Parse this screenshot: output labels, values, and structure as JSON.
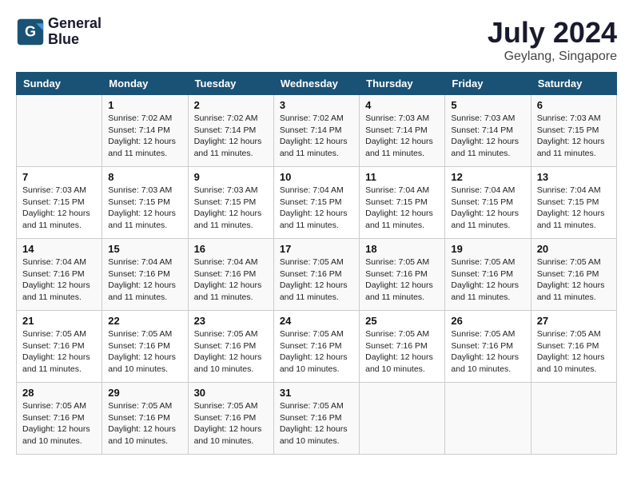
{
  "logo": {
    "line1": "General",
    "line2": "Blue"
  },
  "title": "July 2024",
  "location": "Geylang, Singapore",
  "days_header": [
    "Sunday",
    "Monday",
    "Tuesday",
    "Wednesday",
    "Thursday",
    "Friday",
    "Saturday"
  ],
  "weeks": [
    [
      {
        "day": "",
        "sunrise": "",
        "sunset": "",
        "daylight": ""
      },
      {
        "day": "1",
        "sunrise": "Sunrise: 7:02 AM",
        "sunset": "Sunset: 7:14 PM",
        "daylight": "Daylight: 12 hours and 11 minutes."
      },
      {
        "day": "2",
        "sunrise": "Sunrise: 7:02 AM",
        "sunset": "Sunset: 7:14 PM",
        "daylight": "Daylight: 12 hours and 11 minutes."
      },
      {
        "day": "3",
        "sunrise": "Sunrise: 7:02 AM",
        "sunset": "Sunset: 7:14 PM",
        "daylight": "Daylight: 12 hours and 11 minutes."
      },
      {
        "day": "4",
        "sunrise": "Sunrise: 7:03 AM",
        "sunset": "Sunset: 7:14 PM",
        "daylight": "Daylight: 12 hours and 11 minutes."
      },
      {
        "day": "5",
        "sunrise": "Sunrise: 7:03 AM",
        "sunset": "Sunset: 7:14 PM",
        "daylight": "Daylight: 12 hours and 11 minutes."
      },
      {
        "day": "6",
        "sunrise": "Sunrise: 7:03 AM",
        "sunset": "Sunset: 7:15 PM",
        "daylight": "Daylight: 12 hours and 11 minutes."
      }
    ],
    [
      {
        "day": "7",
        "sunrise": "Sunrise: 7:03 AM",
        "sunset": "Sunset: 7:15 PM",
        "daylight": "Daylight: 12 hours and 11 minutes."
      },
      {
        "day": "8",
        "sunrise": "Sunrise: 7:03 AM",
        "sunset": "Sunset: 7:15 PM",
        "daylight": "Daylight: 12 hours and 11 minutes."
      },
      {
        "day": "9",
        "sunrise": "Sunrise: 7:03 AM",
        "sunset": "Sunset: 7:15 PM",
        "daylight": "Daylight: 12 hours and 11 minutes."
      },
      {
        "day": "10",
        "sunrise": "Sunrise: 7:04 AM",
        "sunset": "Sunset: 7:15 PM",
        "daylight": "Daylight: 12 hours and 11 minutes."
      },
      {
        "day": "11",
        "sunrise": "Sunrise: 7:04 AM",
        "sunset": "Sunset: 7:15 PM",
        "daylight": "Daylight: 12 hours and 11 minutes."
      },
      {
        "day": "12",
        "sunrise": "Sunrise: 7:04 AM",
        "sunset": "Sunset: 7:15 PM",
        "daylight": "Daylight: 12 hours and 11 minutes."
      },
      {
        "day": "13",
        "sunrise": "Sunrise: 7:04 AM",
        "sunset": "Sunset: 7:15 PM",
        "daylight": "Daylight: 12 hours and 11 minutes."
      }
    ],
    [
      {
        "day": "14",
        "sunrise": "Sunrise: 7:04 AM",
        "sunset": "Sunset: 7:16 PM",
        "daylight": "Daylight: 12 hours and 11 minutes."
      },
      {
        "day": "15",
        "sunrise": "Sunrise: 7:04 AM",
        "sunset": "Sunset: 7:16 PM",
        "daylight": "Daylight: 12 hours and 11 minutes."
      },
      {
        "day": "16",
        "sunrise": "Sunrise: 7:04 AM",
        "sunset": "Sunset: 7:16 PM",
        "daylight": "Daylight: 12 hours and 11 minutes."
      },
      {
        "day": "17",
        "sunrise": "Sunrise: 7:05 AM",
        "sunset": "Sunset: 7:16 PM",
        "daylight": "Daylight: 12 hours and 11 minutes."
      },
      {
        "day": "18",
        "sunrise": "Sunrise: 7:05 AM",
        "sunset": "Sunset: 7:16 PM",
        "daylight": "Daylight: 12 hours and 11 minutes."
      },
      {
        "day": "19",
        "sunrise": "Sunrise: 7:05 AM",
        "sunset": "Sunset: 7:16 PM",
        "daylight": "Daylight: 12 hours and 11 minutes."
      },
      {
        "day": "20",
        "sunrise": "Sunrise: 7:05 AM",
        "sunset": "Sunset: 7:16 PM",
        "daylight": "Daylight: 12 hours and 11 minutes."
      }
    ],
    [
      {
        "day": "21",
        "sunrise": "Sunrise: 7:05 AM",
        "sunset": "Sunset: 7:16 PM",
        "daylight": "Daylight: 12 hours and 11 minutes."
      },
      {
        "day": "22",
        "sunrise": "Sunrise: 7:05 AM",
        "sunset": "Sunset: 7:16 PM",
        "daylight": "Daylight: 12 hours and 10 minutes."
      },
      {
        "day": "23",
        "sunrise": "Sunrise: 7:05 AM",
        "sunset": "Sunset: 7:16 PM",
        "daylight": "Daylight: 12 hours and 10 minutes."
      },
      {
        "day": "24",
        "sunrise": "Sunrise: 7:05 AM",
        "sunset": "Sunset: 7:16 PM",
        "daylight": "Daylight: 12 hours and 10 minutes."
      },
      {
        "day": "25",
        "sunrise": "Sunrise: 7:05 AM",
        "sunset": "Sunset: 7:16 PM",
        "daylight": "Daylight: 12 hours and 10 minutes."
      },
      {
        "day": "26",
        "sunrise": "Sunrise: 7:05 AM",
        "sunset": "Sunset: 7:16 PM",
        "daylight": "Daylight: 12 hours and 10 minutes."
      },
      {
        "day": "27",
        "sunrise": "Sunrise: 7:05 AM",
        "sunset": "Sunset: 7:16 PM",
        "daylight": "Daylight: 12 hours and 10 minutes."
      }
    ],
    [
      {
        "day": "28",
        "sunrise": "Sunrise: 7:05 AM",
        "sunset": "Sunset: 7:16 PM",
        "daylight": "Daylight: 12 hours and 10 minutes."
      },
      {
        "day": "29",
        "sunrise": "Sunrise: 7:05 AM",
        "sunset": "Sunset: 7:16 PM",
        "daylight": "Daylight: 12 hours and 10 minutes."
      },
      {
        "day": "30",
        "sunrise": "Sunrise: 7:05 AM",
        "sunset": "Sunset: 7:16 PM",
        "daylight": "Daylight: 12 hours and 10 minutes."
      },
      {
        "day": "31",
        "sunrise": "Sunrise: 7:05 AM",
        "sunset": "Sunset: 7:16 PM",
        "daylight": "Daylight: 12 hours and 10 minutes."
      },
      {
        "day": "",
        "sunrise": "",
        "sunset": "",
        "daylight": ""
      },
      {
        "day": "",
        "sunrise": "",
        "sunset": "",
        "daylight": ""
      },
      {
        "day": "",
        "sunrise": "",
        "sunset": "",
        "daylight": ""
      }
    ]
  ]
}
